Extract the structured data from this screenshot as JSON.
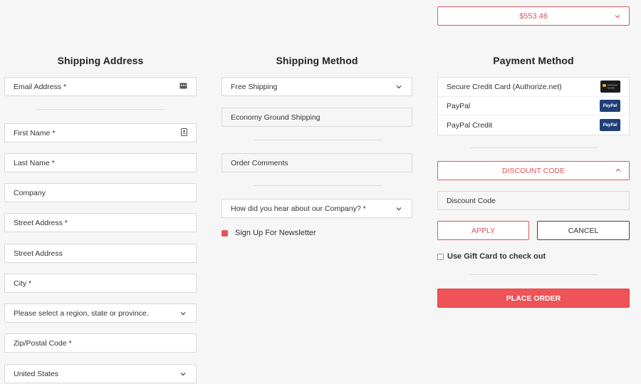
{
  "order_total": {
    "amount": "$553.46"
  },
  "shipping_address": {
    "heading": "Shipping Address",
    "email_placeholder": "Email Address *",
    "first_name_placeholder": "First Name *",
    "last_name_placeholder": "Last Name *",
    "company_placeholder": "Company",
    "street1_placeholder": "Street Address *",
    "street2_placeholder": "Street Address",
    "city_placeholder": "City *",
    "region_placeholder": "Please select a region, state or province.",
    "zip_placeholder": "Zip/Postal Code *",
    "country_value": "United States"
  },
  "shipping_method": {
    "heading": "Shipping Method",
    "method_select": "Free Shipping",
    "method_detail": "Economy Ground Shipping",
    "order_comments_placeholder": "Order Comments",
    "hear_about_select": "How did you hear about our Company? *",
    "newsletter_label": "Sign Up For Newsletter"
  },
  "payment_method": {
    "heading": "Payment Method",
    "options": [
      {
        "label": "Secure Credit Card (Authorize.net)",
        "icon": "credit-card-icon"
      },
      {
        "label": "PayPal",
        "icon": "paypal-icon",
        "logo_text": "PayPal"
      },
      {
        "label": "PayPal Credit",
        "icon": "paypal-icon",
        "logo_text": "PayPal"
      }
    ],
    "discount_toggle": "DISCOUNT CODE",
    "discount_placeholder": "Discount Code",
    "apply_label": "APPLY",
    "cancel_label": "CANCEL",
    "gift_card_label": "Use Gift Card to check out",
    "place_order_label": "PLACE ORDER"
  },
  "colors": {
    "accent": "#e0555a",
    "place_order_bg": "#ef5257",
    "paypal_blue": "#1f3f76"
  }
}
